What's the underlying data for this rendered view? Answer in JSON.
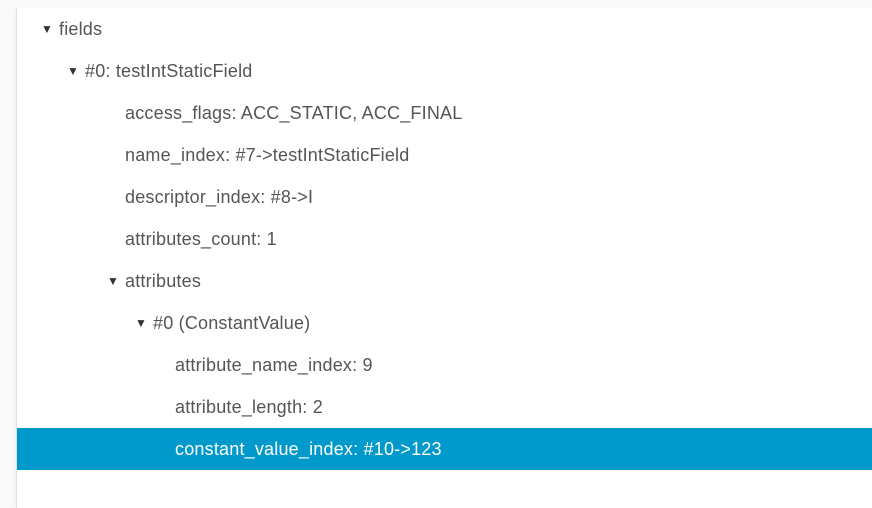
{
  "tree": {
    "root": {
      "label": "fields",
      "children": [
        {
          "label": "#0: testIntStaticField",
          "props": [
            {
              "label": "access_flags: ACC_STATIC, ACC_FINAL"
            },
            {
              "label": "name_index: #7->testIntStaticField"
            },
            {
              "label": "descriptor_index: #8->I"
            },
            {
              "label": "attributes_count: 1"
            }
          ],
          "attributes": {
            "label": "attributes",
            "children": [
              {
                "label": "#0 (ConstantValue)",
                "props": [
                  {
                    "label": "attribute_name_index: 9"
                  },
                  {
                    "label": "attribute_length: 2"
                  },
                  {
                    "label": "constant_value_index: #10->123",
                    "selected": true
                  }
                ]
              }
            ]
          }
        }
      ]
    }
  }
}
